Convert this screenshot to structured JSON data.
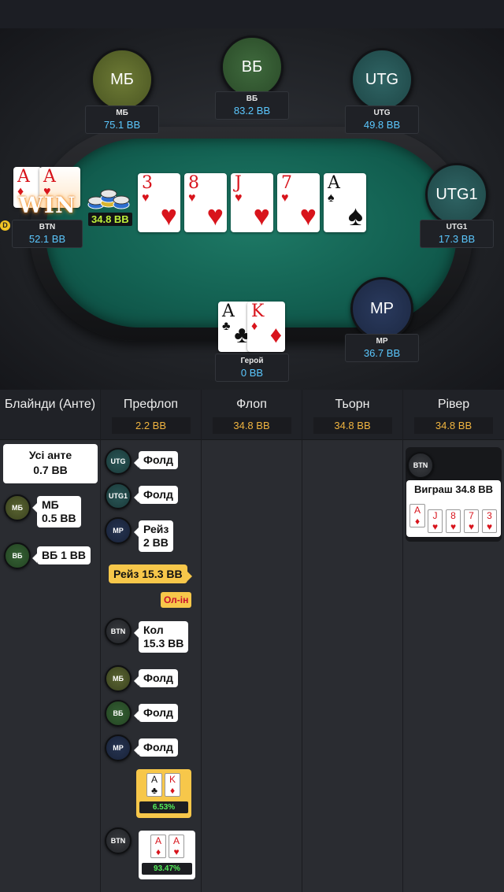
{
  "colors": {
    "stat": "#5bc8ff",
    "pot": "#f0b440",
    "hero_win": "#54f05a"
  },
  "seats": {
    "mb": {
      "avatar": "МБ",
      "name": "МБ",
      "stack": "75.1 BB"
    },
    "vb": {
      "avatar": "ВБ",
      "name": "ВБ",
      "stack": "83.2 BB"
    },
    "utg": {
      "avatar": "UTG",
      "name": "UTG",
      "stack": "49.8 BB"
    },
    "utg1": {
      "avatar": "UTG1",
      "name": "UTG1",
      "stack": "17.3 BB"
    },
    "mp": {
      "avatar": "MP",
      "name": "MP",
      "stack": "36.7 BB"
    },
    "btn": {
      "name": "BTN",
      "stack": "52.1 BB",
      "card1": "A",
      "card2": "A",
      "win": "WIN",
      "dealer": "D"
    },
    "hero": {
      "name": "Герой",
      "stack": "0 BB",
      "card1": "A",
      "card2": "K"
    }
  },
  "pot": "34.8 BB",
  "board": [
    {
      "rank": "3",
      "suit": "♥"
    },
    {
      "rank": "8",
      "suit": "♥"
    },
    {
      "rank": "J",
      "suit": "♥"
    },
    {
      "rank": "7",
      "suit": "♥"
    },
    {
      "rank": "A",
      "suit": "♠"
    }
  ],
  "history": {
    "cols": [
      {
        "title": "Блайнди (Анте)",
        "amount": ""
      },
      {
        "title": "Префлоп",
        "amount": "2.2 BB"
      },
      {
        "title": "Флоп",
        "amount": "34.8 BB"
      },
      {
        "title": "Тьорн",
        "amount": "34.8 BB"
      },
      {
        "title": "Рівер",
        "amount": "34.8 BB"
      }
    ],
    "blinds": {
      "ante_line1": "Усі анте",
      "ante_line2": "0.7 BB",
      "mb_pill": "МБ",
      "mb_line1": "МБ",
      "mb_line2": "0.5 BB",
      "vb_pill": "ВБ",
      "vb_text": "ВБ 1 BB"
    },
    "preflop": {
      "a1_pill": "UTG",
      "a1": "Фолд",
      "a2_pill": "UTG1",
      "a2": "Фолд",
      "a3_pill": "MP",
      "a3_l1": "Рейз",
      "a3_l2": "2 BB",
      "hero_raise": "Рейз 15.3 BB",
      "allin": "Ол-ін",
      "a5_pill": "BTN",
      "a5_l1": "Кол",
      "a5_l2": "15.3 BB",
      "a6_pill": "МБ",
      "a6": "Фолд",
      "a7_pill": "ВБ",
      "a7": "Фолд",
      "a8_pill": "MP",
      "a8": "Фолд",
      "hero_c1": "A",
      "hero_c2": "K",
      "hero_eq": "6.53%",
      "btn_pill": "BTN",
      "btn_c1": "A",
      "btn_c2": "A",
      "btn_eq": "93.47%"
    },
    "river": {
      "pill": "BTN",
      "win": "Виграш 34.8 BB",
      "cards": [
        "A",
        "J",
        "8",
        "7",
        "3"
      ]
    }
  }
}
